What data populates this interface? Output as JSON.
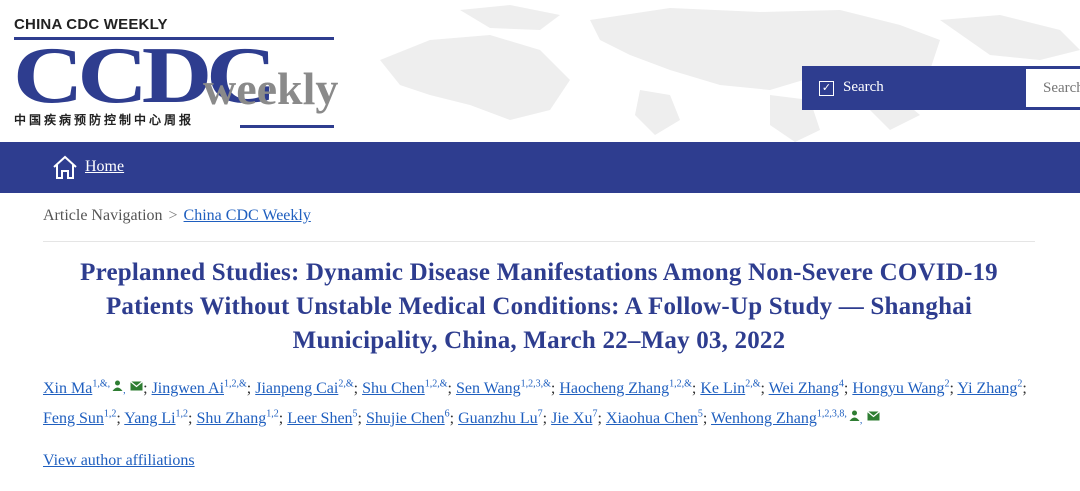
{
  "header": {
    "brand_top": "CHINA CDC WEEKLY",
    "logo_main": "CCDC",
    "logo_suffix": "weekly",
    "logo_cn": "中国疾病预防控制中心周报",
    "colors": {
      "brand": "#2e3d8f",
      "link": "#1f5fbf",
      "suffix_gray": "#8a8a8a"
    }
  },
  "search": {
    "checkbox_glyph": "✓",
    "label": "Search",
    "placeholder": "Search"
  },
  "nav": {
    "home_label": "Home",
    "home_icon": "home-icon"
  },
  "breadcrumb": {
    "label": "Article Navigation",
    "separator": ">",
    "link": "China CDC Weekly"
  },
  "article": {
    "title": "Preplanned Studies: Dynamic Disease Manifestations Among Non-Severe COVID-19 Patients Without Unstable Medical Conditions: A Follow-Up Study — Shanghai Municipality, China, March 22–May 03, 2022",
    "authors": [
      {
        "name": "Xin Ma",
        "sup": "1,&,",
        "icons": true
      },
      {
        "name": "Jingwen Ai",
        "sup": "1,2,&"
      },
      {
        "name": "Jianpeng Cai",
        "sup": "2,&"
      },
      {
        "name": "Shu Chen",
        "sup": "1,2,&"
      },
      {
        "name": "Sen Wang",
        "sup": "1,2,3,&"
      },
      {
        "name": "Haocheng Zhang",
        "sup": "1,2,&"
      },
      {
        "name": "Ke Lin",
        "sup": "2,&"
      },
      {
        "name": "Wei Zhang",
        "sup": "4"
      },
      {
        "name": "Hongyu Wang",
        "sup": "2"
      },
      {
        "name": "Yi Zhang",
        "sup": "2"
      },
      {
        "name": "Feng Sun",
        "sup": "1,2"
      },
      {
        "name": "Yang Li",
        "sup": "1,2"
      },
      {
        "name": "Shu Zhang",
        "sup": "1,2"
      },
      {
        "name": "Leer Shen",
        "sup": "5"
      },
      {
        "name": "Shujie Chen",
        "sup": "6"
      },
      {
        "name": "Guanzhu Lu",
        "sup": "7"
      },
      {
        "name": "Jie Xu",
        "sup": "7"
      },
      {
        "name": "Xiaohua Chen",
        "sup": "5"
      },
      {
        "name": "Wenhong Zhang",
        "sup": "1,2,3,8,",
        "icons": true
      }
    ],
    "author_separator": ";",
    "affiliations_link": "View author affiliations"
  }
}
